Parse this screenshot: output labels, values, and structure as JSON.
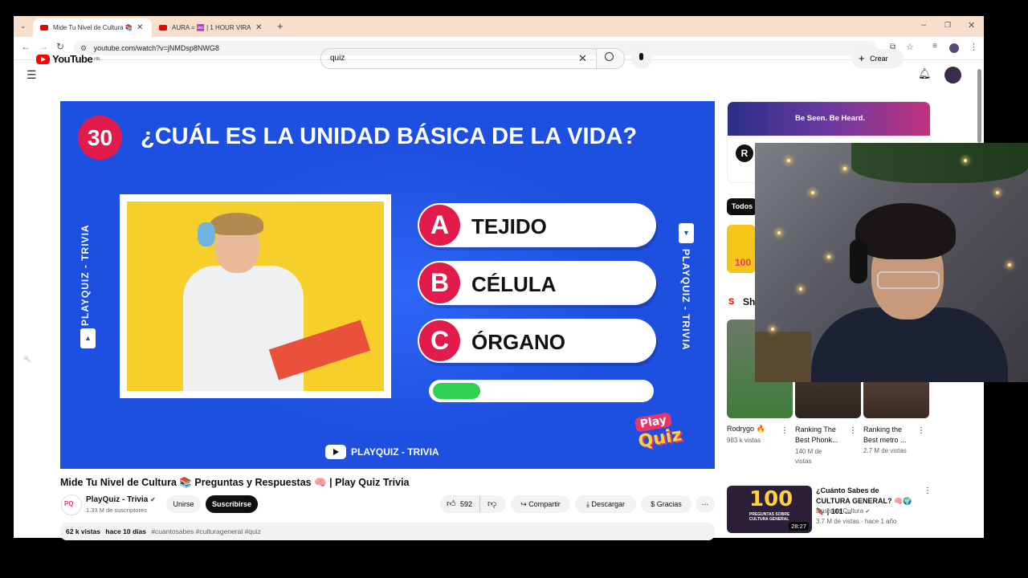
{
  "browser": {
    "tabs": [
      {
        "title": "Mide Tu Nivel de Cultura 📚 🔊",
        "active": true
      },
      {
        "title": "AURA = ♾️ | 1 HOUR VIRA 🔊",
        "active": false
      }
    ],
    "url": "youtube.com/watch?v=jNMDsp8NWG8"
  },
  "youtube": {
    "logo_text": "YouTube",
    "region": "HN",
    "search_value": "quiz",
    "create_label": "Crear"
  },
  "video": {
    "question_number": "30",
    "question": "¿CUÁL ES LA UNIDAD BÁSICA DE LA VIDA?",
    "options": [
      {
        "letter": "A",
        "text": "TEJIDO"
      },
      {
        "letter": "B",
        "text": "CÉLULA"
      },
      {
        "letter": "C",
        "text": "ÓRGANO"
      }
    ],
    "timer_progress": 0.22,
    "side_label": "PLAYQUIZ - TRIVIA",
    "channel_mark": "PLAYQUIZ - TRIVIA",
    "logo_line1": "Play",
    "logo_line2": "Quiz"
  },
  "details": {
    "title": "Mide Tu Nivel de Cultura 📚 Preguntas y Respuestas 🧠 | Play Quiz Trivia",
    "channel": "PlayQuiz - Trivia",
    "subscribers": "1.33 M de suscriptores",
    "join_label": "Unirse",
    "subscribe_label": "Suscribirse",
    "likes": "592",
    "share_label": "Compartir",
    "download_label": "Descargar",
    "thanks_label": "Gracias",
    "views": "62 k vistas",
    "date": "hace 10 días",
    "tags": "#cuantosabes #culturageneral #quiz"
  },
  "sidebar": {
    "ad_text": "Be Seen. Be Heard.",
    "ad_letter": "R",
    "chip_all": "Todos",
    "shorts_label": "Sh",
    "shorts": [
      {
        "title": "Rodrygo 🔥",
        "meta": "983 k vistas"
      },
      {
        "title": "Ranking The Best Phonk...",
        "meta": "140 M de vistas"
      },
      {
        "title": "Ranking the Best metro ...",
        "meta": "2.7 M de vistas"
      }
    ],
    "rec": {
      "title": "¿Cuánto Sabes de CULTURA GENERAL? 🧠🌍 🔖 | 101 ...",
      "channel": "Dosis de Cultura",
      "meta": "3.7 M de vistas · hace 1 año",
      "duration": "28:27",
      "thumb_number": "100",
      "thumb_caption": "PREGUNTAS SOBRE CULTURA GENERAL"
    }
  }
}
